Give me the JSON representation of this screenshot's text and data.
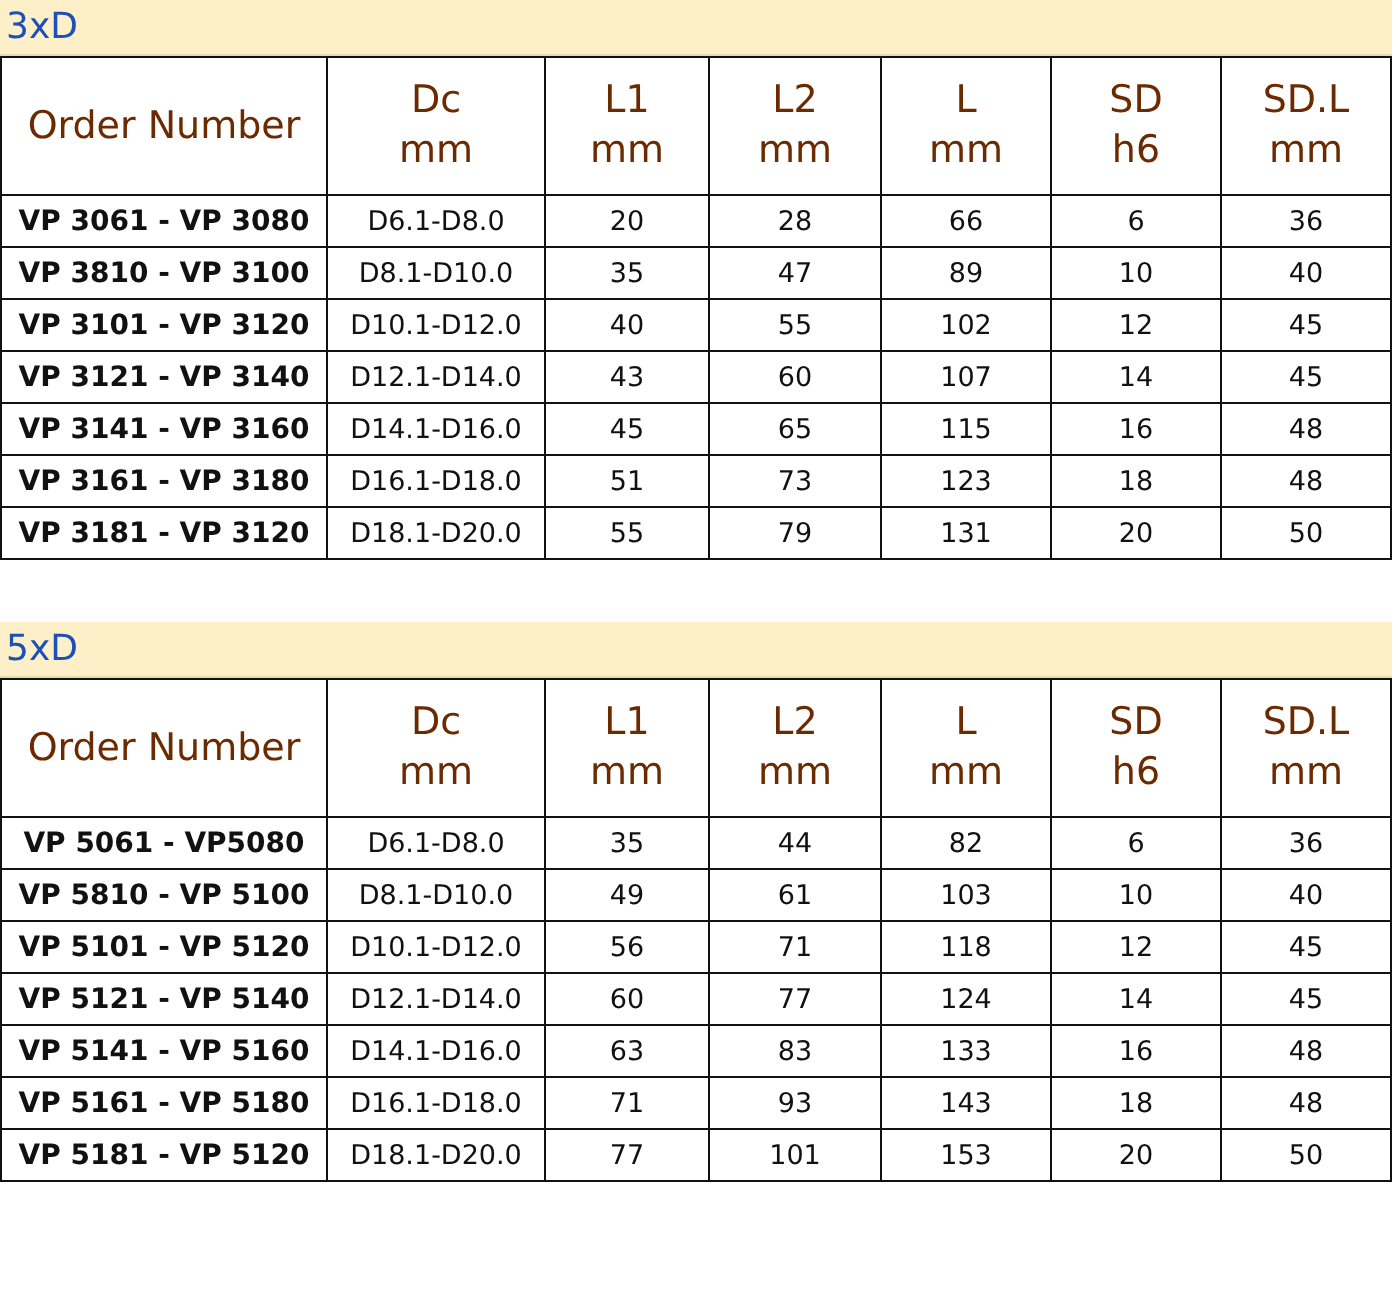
{
  "tables": [
    {
      "title": "3xD",
      "columns": [
        "Order Number",
        "Dc\nmm",
        "L1\nmm",
        "L2\nmm",
        "L\nmm",
        "SD\nh6",
        "SD.L\nmm"
      ],
      "rows": [
        [
          "VP 3061 - VP 3080",
          "D6.1-D8.0",
          "20",
          "28",
          "66",
          "6",
          "36"
        ],
        [
          "VP 3810 - VP 3100",
          "D8.1-D10.0",
          "35",
          "47",
          "89",
          "10",
          "40"
        ],
        [
          "VP 3101 - VP 3120",
          "D10.1-D12.0",
          "40",
          "55",
          "102",
          "12",
          "45"
        ],
        [
          "VP 3121 - VP 3140",
          "D12.1-D14.0",
          "43",
          "60",
          "107",
          "14",
          "45"
        ],
        [
          "VP 3141 - VP 3160",
          "D14.1-D16.0",
          "45",
          "65",
          "115",
          "16",
          "48"
        ],
        [
          "VP 3161 - VP 3180",
          "D16.1-D18.0",
          "51",
          "73",
          "123",
          "18",
          "48"
        ],
        [
          "VP 3181 - VP 3120",
          "D18.1-D20.0",
          "55",
          "79",
          "131",
          "20",
          "50"
        ]
      ]
    },
    {
      "title": "5xD",
      "columns": [
        "Order Number",
        "Dc\nmm",
        "L1\nmm",
        "L2\nmm",
        "L\nmm",
        "SD\nh6",
        "SD.L\nmm"
      ],
      "rows": [
        [
          "VP 5061 - VP5080",
          "D6.1-D8.0",
          "35",
          "44",
          "82",
          "6",
          "36"
        ],
        [
          "VP 5810 - VP 5100",
          "D8.1-D10.0",
          "49",
          "61",
          "103",
          "10",
          "40"
        ],
        [
          "VP 5101 - VP 5120",
          "D10.1-D12.0",
          "56",
          "71",
          "118",
          "12",
          "45"
        ],
        [
          "VP 5121 - VP 5140",
          "D12.1-D14.0",
          "60",
          "77",
          "124",
          "14",
          "45"
        ],
        [
          "VP 5141 - VP 5160",
          "D14.1-D16.0",
          "63",
          "83",
          "133",
          "16",
          "48"
        ],
        [
          "VP 5161 - VP 5180",
          "D16.1-D18.0",
          "71",
          "93",
          "143",
          "18",
          "48"
        ],
        [
          "VP 5181 - VP 5120",
          "D18.1-D20.0",
          "77",
          "101",
          "153",
          "20",
          "50"
        ]
      ]
    }
  ]
}
